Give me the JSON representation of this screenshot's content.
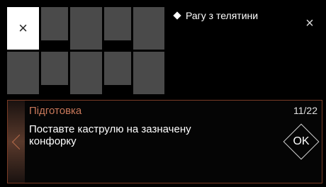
{
  "burner_grid": {
    "selected_icon": "close-icon",
    "selected_symbol": "×"
  },
  "header": {
    "title_icon": "diamond-bullet-icon",
    "title": "Рагу з телятини",
    "close_icon": "close-icon",
    "close_symbol": "×"
  },
  "step": {
    "category": "Підготовка",
    "counter": "11/22",
    "instruction": "Поставте каструлю на зазначену конфорку",
    "back_icon": "chevron-left-icon",
    "ok_label": "OK"
  },
  "colors": {
    "accent": "#c8785a",
    "border": "#7a3c26",
    "cell": "#4a4a4a",
    "selected_cell": "#ffffff"
  }
}
